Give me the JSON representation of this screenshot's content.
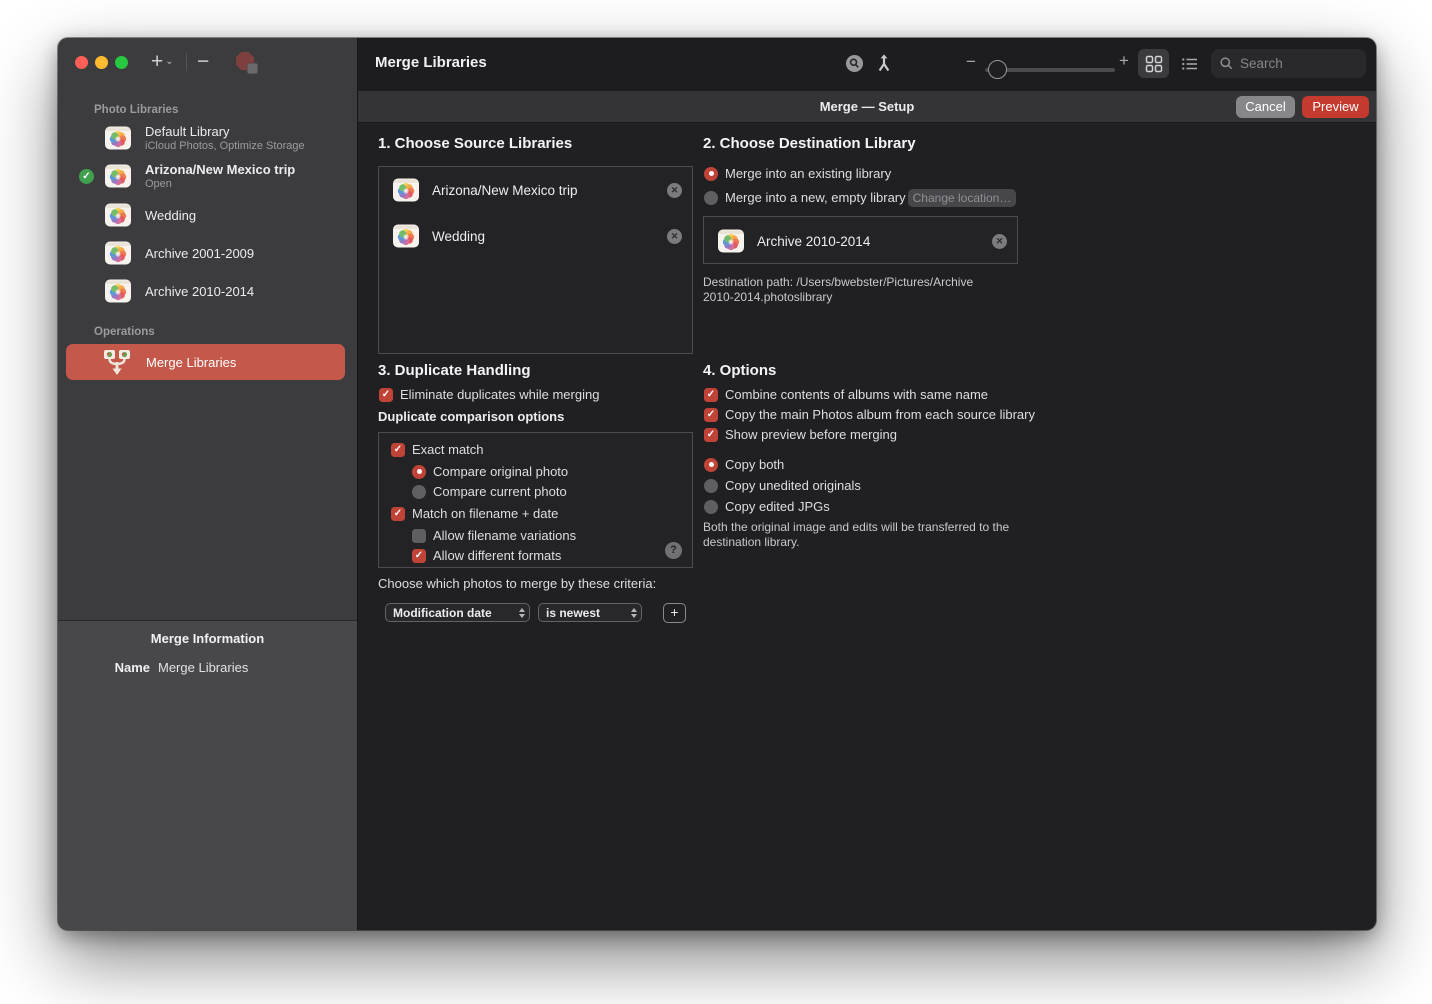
{
  "glyphs": {
    "plus": "+",
    "minus": "−",
    "chevron_down": "⌄",
    "check": "✓",
    "close": "✕",
    "help": "?",
    "zoom_minus": "−",
    "zoom_plus": "+"
  },
  "window": {
    "sidebar": {
      "section_photo_libraries": "Photo Libraries",
      "libraries": [
        {
          "title": "Default Library",
          "subtitle": "iCloud Photos, Optimize Storage"
        },
        {
          "title": "Arizona/New Mexico trip",
          "subtitle": "Open"
        },
        {
          "title": "Wedding",
          "subtitle": ""
        },
        {
          "title": "Archive 2001-2009",
          "subtitle": ""
        },
        {
          "title": "Archive 2010-2014",
          "subtitle": ""
        }
      ],
      "open_library_index": 1,
      "section_operations": "Operations",
      "merge_item_label": "Merge Libraries",
      "info_title": "Merge Information",
      "name_label": "Name",
      "name_value": "Merge Libraries"
    },
    "toolbar": {
      "title": "Merge Libraries",
      "search_placeholder": "Search"
    },
    "action_bar": {
      "title": "Merge — Setup",
      "cancel_label": "Cancel",
      "preview_label": "Preview"
    },
    "sections": {
      "source": {
        "heading": "1. Choose Source Libraries",
        "items": [
          "Arizona/New Mexico trip",
          "Wedding"
        ]
      },
      "destination": {
        "heading": "2. Choose Destination Library",
        "radio_existing": "Merge into an existing library",
        "radio_existing_selected": true,
        "radio_new": "Merge into a new, empty library",
        "radio_new_selected": false,
        "change_location_label": "Change location…",
        "selected_library": "Archive 2010-2014",
        "path_text": "Destination path: /Users/bwebster/Pictures/Archive 2010-2014.photoslibrary"
      },
      "duplicates": {
        "heading": "3. Duplicate Handling",
        "eliminate_label": "Eliminate duplicates while merging",
        "eliminate_checked": true,
        "comparison_title": "Duplicate comparison options",
        "exact_match_label": "Exact match",
        "exact_match_checked": true,
        "compare_original_label": "Compare original photo",
        "compare_original_selected": true,
        "compare_current_label": "Compare current photo",
        "compare_current_selected": false,
        "match_filename_label": "Match on filename + date",
        "match_filename_checked": true,
        "allow_variations_label": "Allow filename variations",
        "allow_variations_checked": false,
        "allow_formats_label": "Allow different formats",
        "allow_formats_checked": true,
        "criteria_caption": "Choose which photos to merge by these criteria:",
        "criteria_field_value": "Modification date",
        "criteria_rule_value": "is newest"
      },
      "options": {
        "heading": "4. Options",
        "checkboxes": [
          "Combine contents of albums with same name",
          "Copy the main Photos album from each source library",
          "Show preview before merging"
        ],
        "checkbox_states": [
          true,
          true,
          true
        ],
        "radios": [
          "Copy both",
          "Copy unedited originals",
          "Copy edited JPGs"
        ],
        "radio_selected_index": 0,
        "note": "Both the original image and edits will be transferred to the destination library."
      }
    },
    "colors": {
      "accent_red": "#bf4337",
      "selection_red": "#c4584a",
      "preview_red": "#c53a2e"
    }
  }
}
